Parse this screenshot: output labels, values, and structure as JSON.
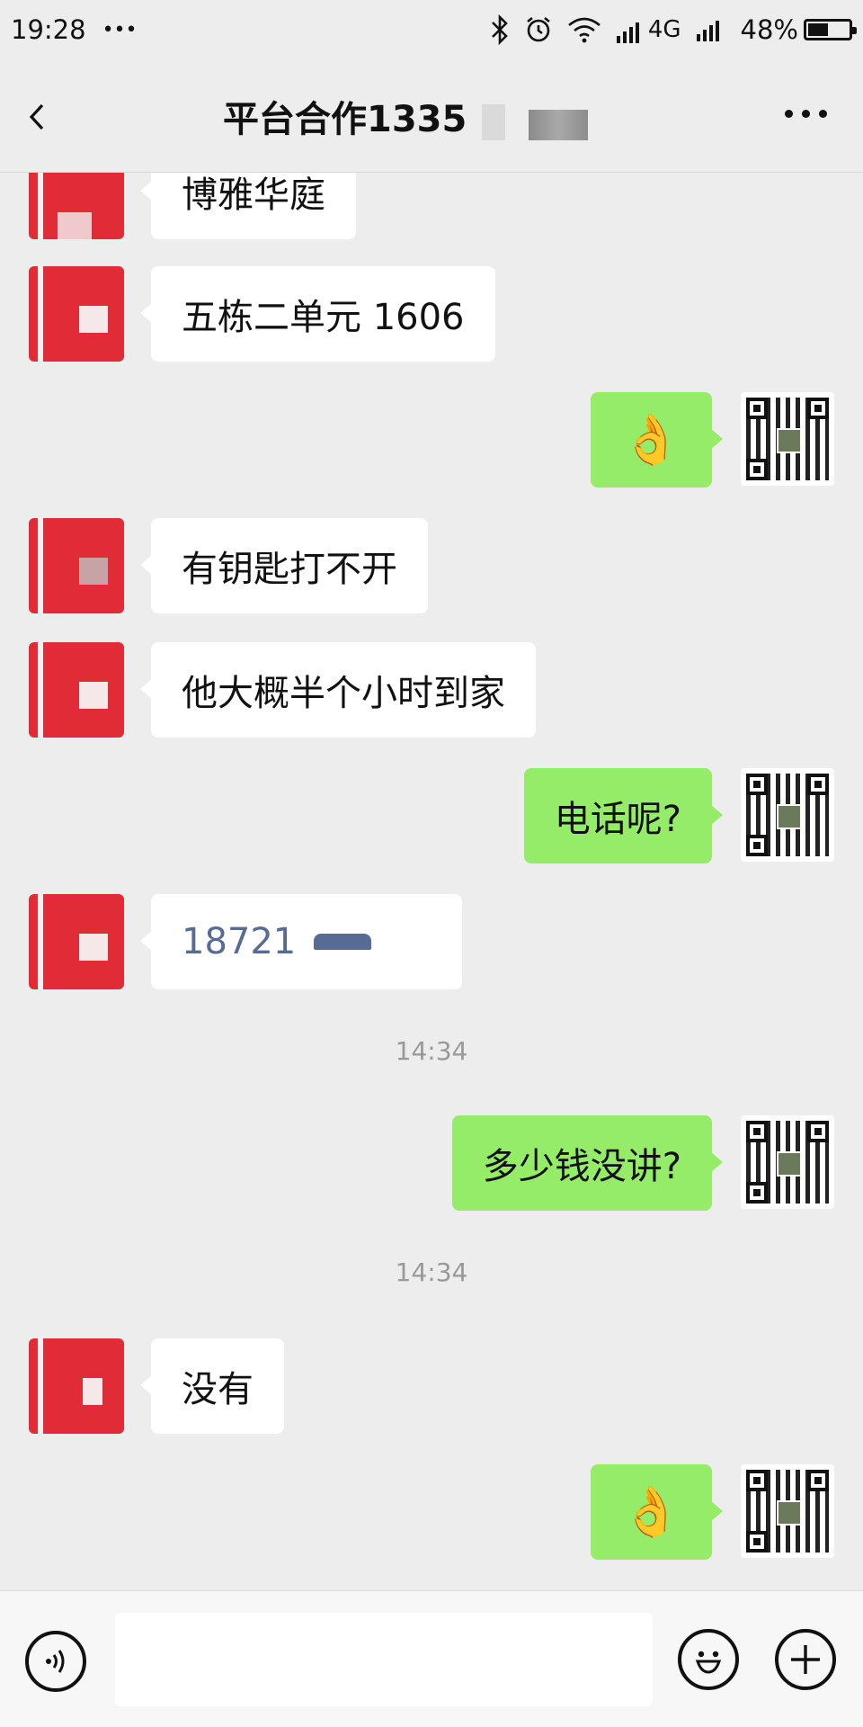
{
  "status_bar": {
    "time": "19:28",
    "dots": "•••",
    "network": "4G",
    "battery_percent": "48%"
  },
  "nav": {
    "title": "平台合作1335"
  },
  "messages": [
    {
      "side": "left",
      "text": "博雅华庭"
    },
    {
      "side": "left",
      "text": "五栋二单元 1606"
    },
    {
      "side": "right",
      "text": "👌"
    },
    {
      "side": "left",
      "text": "有钥匙打不开"
    },
    {
      "side": "left",
      "text": "他大概半个小时到家"
    },
    {
      "side": "right",
      "text": "电话呢?"
    },
    {
      "side": "left",
      "text": "18721"
    },
    {
      "type": "time",
      "text": "14:34"
    },
    {
      "side": "right",
      "text": "多少钱没讲?"
    },
    {
      "type": "time",
      "text": "14:34"
    },
    {
      "side": "left",
      "text": "没有"
    },
    {
      "side": "right",
      "text": "👌"
    }
  ],
  "colors": {
    "background": "#ededed",
    "bubble_self": "#95ec69",
    "bubble_other": "#ffffff",
    "link": "#576b95",
    "avatar_other": "#e12b36"
  },
  "icons": {
    "back": "chevron-left-icon",
    "more": "more-icon",
    "voice": "voice-icon",
    "emoji": "emoji-icon",
    "plus": "plus-icon"
  }
}
